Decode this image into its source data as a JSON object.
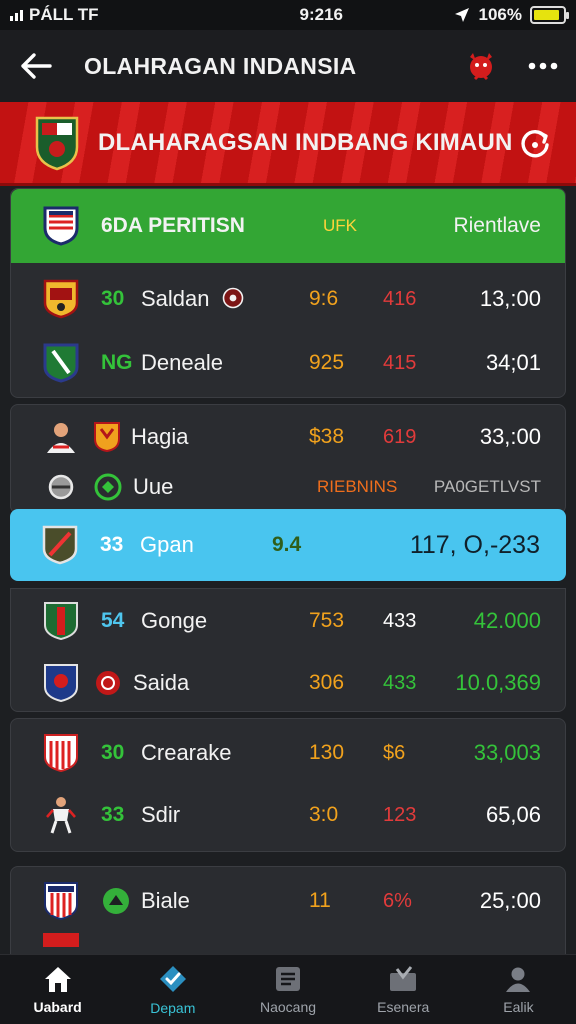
{
  "status_bar": {
    "carrier": "PÁLL  TF",
    "time": "9:216",
    "battery": "106%",
    "battery_level": 0.88
  },
  "app_bar": {
    "title": "OLAHRAGAN INDANSIA",
    "back_icon": "arrow-left-icon",
    "logo_icon": "red-mascot-icon",
    "more_icon": "more-dots-icon"
  },
  "banner": {
    "title": "DLAHARAGSAN INDBANG KIMAUN",
    "refresh_icon": "refresh-icon"
  },
  "table_header": {
    "label": "6DA PERITISN",
    "middle": "UFK",
    "right": "Rientlave"
  },
  "rows_group1": [
    {
      "rank": "30",
      "name": "Saldan",
      "c1": "9:6",
      "c2": "416",
      "c3": "13,:00",
      "rank_color": "#34c33a",
      "c1_color": "#f1a21d",
      "c2_color": "#e23b3b",
      "c3_color": "#ffffff"
    },
    {
      "rank": "NG",
      "name": "Deneale",
      "c1": "925",
      "c2": "415",
      "c3": "34;01",
      "rank_color": "#34c33a",
      "c1_color": "#f1a21d",
      "c2_color": "#e23b3b",
      "c3_color": "#ffffff"
    }
  ],
  "rows_group2": [
    {
      "rank": "",
      "name": "Hagia",
      "c1": "$38",
      "c2": "619",
      "c3": "33,:00",
      "rank_color": "#34c33a",
      "c1_color": "#f1a21d",
      "c2_color": "#e23b3b",
      "c3_color": "#ffffff"
    },
    {
      "rank": "",
      "name": "Uue",
      "subheader_left": "RIEBNINS",
      "subheader_right": "PA0GETLVST",
      "rank_color": "#34c33a"
    }
  ],
  "highlight_row": {
    "rank": "33",
    "name": "Gpan",
    "c1": "9.4",
    "c3": "117, O,-233"
  },
  "rows_group3": [
    {
      "rank": "54",
      "name": "Gonge",
      "c1": "753",
      "c2": "433",
      "c3": "42.000",
      "rank_color": "#4fc6ee",
      "c1_color": "#f1a21d",
      "c2_color": "#ffffff",
      "c3_color": "#34c33a"
    },
    {
      "rank": "",
      "name": "Saida",
      "c1": "306",
      "c2": "433",
      "c3": "10.0,369",
      "rank_color": "#34c33a",
      "c1_color": "#f1a21d",
      "c2_color": "#34c33a",
      "c3_color": "#34c33a"
    }
  ],
  "rows_group4": [
    {
      "rank": "30",
      "name": "Crearake",
      "c1": "130",
      "c2": "$6",
      "c3": "33,003",
      "rank_color": "#34c33a",
      "c1_color": "#f1a21d",
      "c2_color": "#f1a21d",
      "c3_color": "#34c33a"
    },
    {
      "rank": "33",
      "name": "Sdir",
      "c1": "3:0",
      "c2": "123",
      "c3": "65,06",
      "rank_color": "#34c33a",
      "c1_color": "#f1a21d",
      "c2_color": "#e23b3b",
      "c3_color": "#ffffff"
    }
  ],
  "rows_group5": [
    {
      "rank": "",
      "name": "Biale",
      "c1": "11",
      "c2": "6%",
      "c3": "25,:00",
      "rank_color": "#34c33a",
      "c1_color": "#f1a21d",
      "c2_color": "#e23b3b",
      "c3_color": "#ffffff"
    }
  ],
  "bottom_nav": [
    {
      "label": "Uabard",
      "icon": "home-icon"
    },
    {
      "label": "Depam",
      "icon": "check-shield-icon"
    },
    {
      "label": "Naocang",
      "icon": "list-icon"
    },
    {
      "label": "Esenera",
      "icon": "ballot-icon"
    },
    {
      "label": "Ealik",
      "icon": "user-icon"
    }
  ]
}
